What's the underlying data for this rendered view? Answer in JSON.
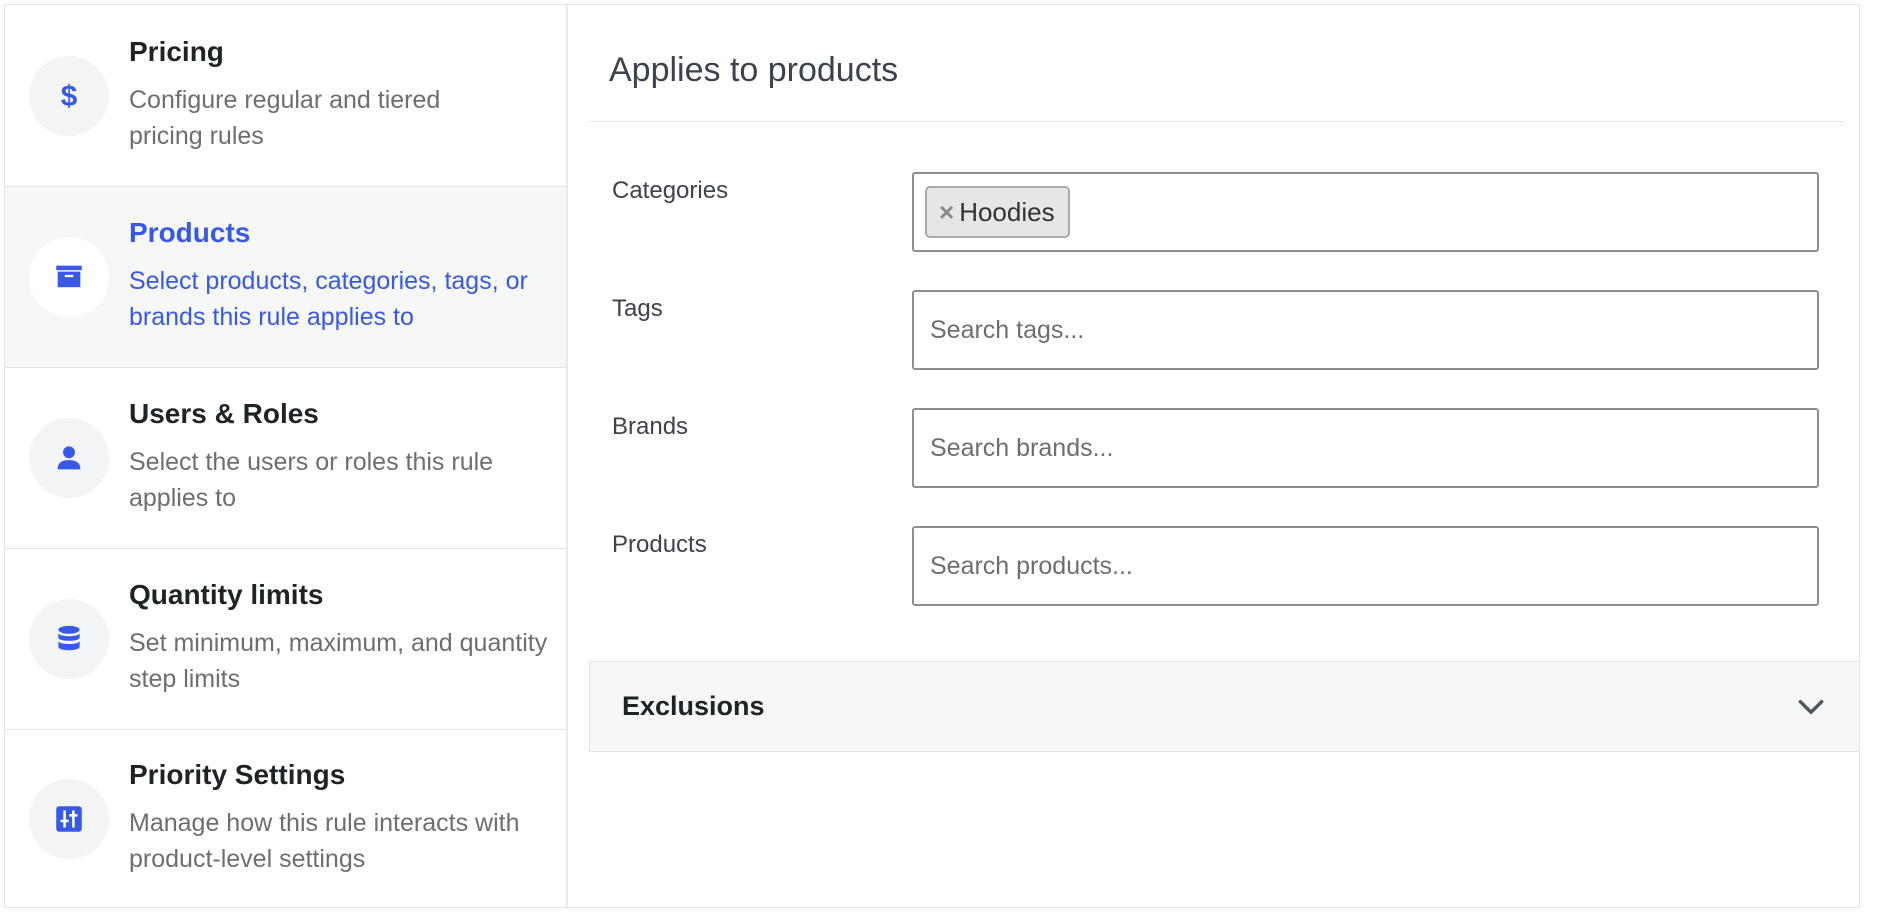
{
  "sidebar": {
    "items": [
      {
        "title": "Pricing",
        "desc": "Configure regular and tiered pricing rules",
        "icon": "dollar-icon",
        "active": false
      },
      {
        "title": "Products",
        "desc": "Select products, categories, tags, or brands this rule applies to",
        "icon": "archive-box-icon",
        "active": true
      },
      {
        "title": "Users & Roles",
        "desc": "Select the users or roles this rule applies to",
        "icon": "user-icon",
        "active": false
      },
      {
        "title": "Quantity limits",
        "desc": "Set minimum, maximum, and quantity step limits",
        "icon": "database-icon",
        "active": false
      },
      {
        "title": "Priority Settings",
        "desc": "Manage how this rule interacts with product-level settings",
        "icon": "sliders-icon",
        "active": false
      }
    ]
  },
  "main": {
    "title": "Applies to products",
    "categories": {
      "label": "Categories",
      "tokens": [
        {
          "remove": "×",
          "label": "Hoodies"
        }
      ]
    },
    "tags": {
      "label": "Tags",
      "placeholder": "Search tags..."
    },
    "brands": {
      "label": "Brands",
      "placeholder": "Search brands..."
    },
    "products": {
      "label": "Products",
      "placeholder": "Search products..."
    },
    "exclusions": {
      "label": "Exclusions"
    }
  },
  "colors": {
    "accent": "#3858e9",
    "text": "#1d2327",
    "muted": "#6b6f74",
    "active_bg": "#f6f7f7",
    "border": "#8c8f94"
  }
}
